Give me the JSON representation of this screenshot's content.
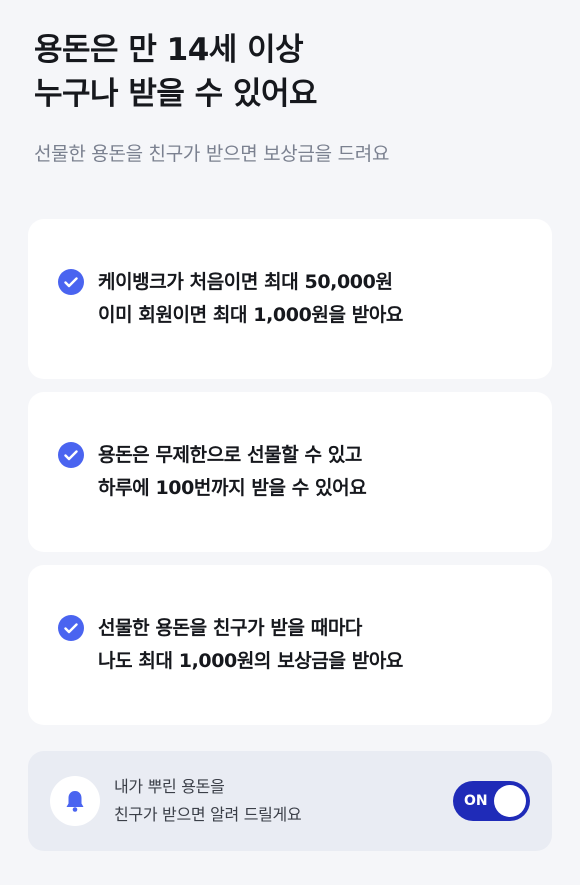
{
  "header": {
    "title_line1": "용돈은 만 14세 이상",
    "title_line2": "누구나 받을 수 있어요",
    "subtitle": "선물한 용돈을 친구가 받으면 보상금을 드려요"
  },
  "benefits": [
    {
      "icon": "check-circle-icon",
      "line1": "케이뱅크가 처음이면 최대 50,000원",
      "line2": "이미 회원이면 최대 1,000원을 받아요"
    },
    {
      "icon": "check-circle-icon",
      "line1": "용돈은 무제한으로 선물할 수 있고",
      "line2": "하루에 100번까지 받을 수 있어요"
    },
    {
      "icon": "check-circle-icon",
      "line1": "선물한 용돈을 친구가 받을 때마다",
      "line2": "나도 최대 1,000원의 보상금을 받아요"
    }
  ],
  "notification": {
    "icon": "bell-icon",
    "line1": "내가 뿌린 용돈을",
    "line2": "친구가 받으면 알려 드릴게요",
    "toggle_label": "ON",
    "toggle_on": true
  },
  "colors": {
    "accent": "#4a64f0",
    "toggle": "#1f2bb8",
    "background": "#f5f6f9",
    "notify_bg": "#e9ecf3"
  }
}
